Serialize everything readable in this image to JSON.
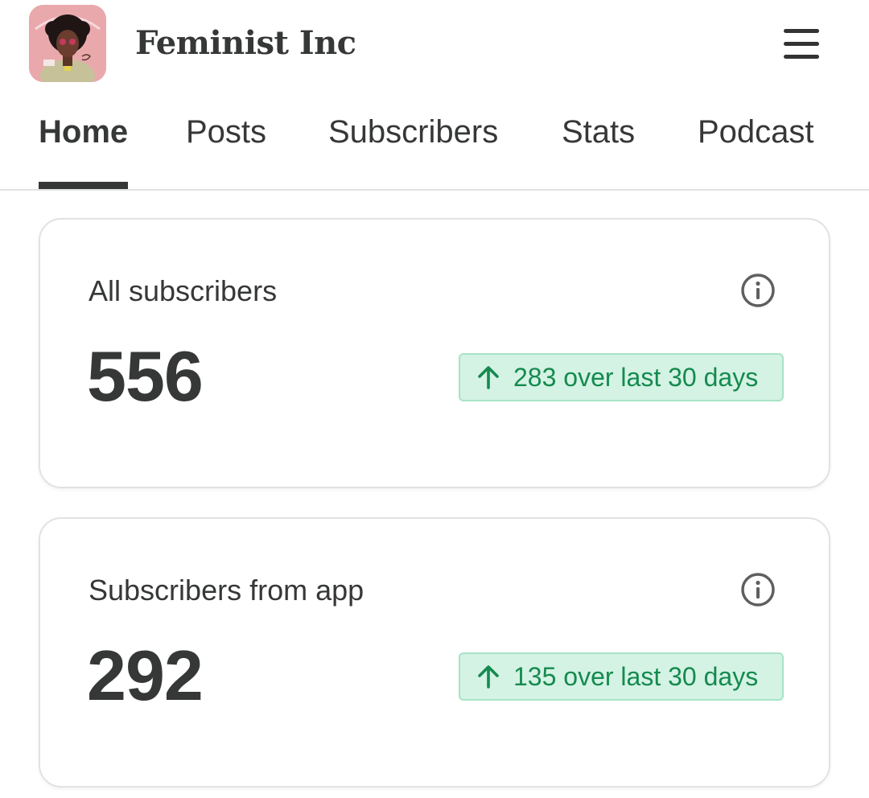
{
  "header": {
    "publication_name": "Feminist Inc",
    "logo_icon": "publication-logo-avatar",
    "menu_icon": "hamburger-menu-icon"
  },
  "tabs": [
    {
      "label": "Home",
      "active": true
    },
    {
      "label": "Posts",
      "active": false
    },
    {
      "label": "Subscribers",
      "active": false
    },
    {
      "label": "Stats",
      "active": false
    },
    {
      "label": "Podcast",
      "active": false
    }
  ],
  "cards": [
    {
      "label": "All subscribers",
      "value": "556",
      "delta_text": "283 over last 30 days",
      "delta_icon": "arrow-up-icon",
      "info_icon": "info-icon"
    },
    {
      "label": "Subscribers from app",
      "value": "292",
      "delta_text": "135 over last 30 days",
      "delta_icon": "arrow-up-icon",
      "info_icon": "info-icon"
    }
  ],
  "colors": {
    "text": "#363737",
    "badge_bg": "#d4f3e4",
    "badge_border": "#a8e3c7",
    "badge_text": "#158a4f",
    "logo_bg": "#e8a5a8"
  }
}
